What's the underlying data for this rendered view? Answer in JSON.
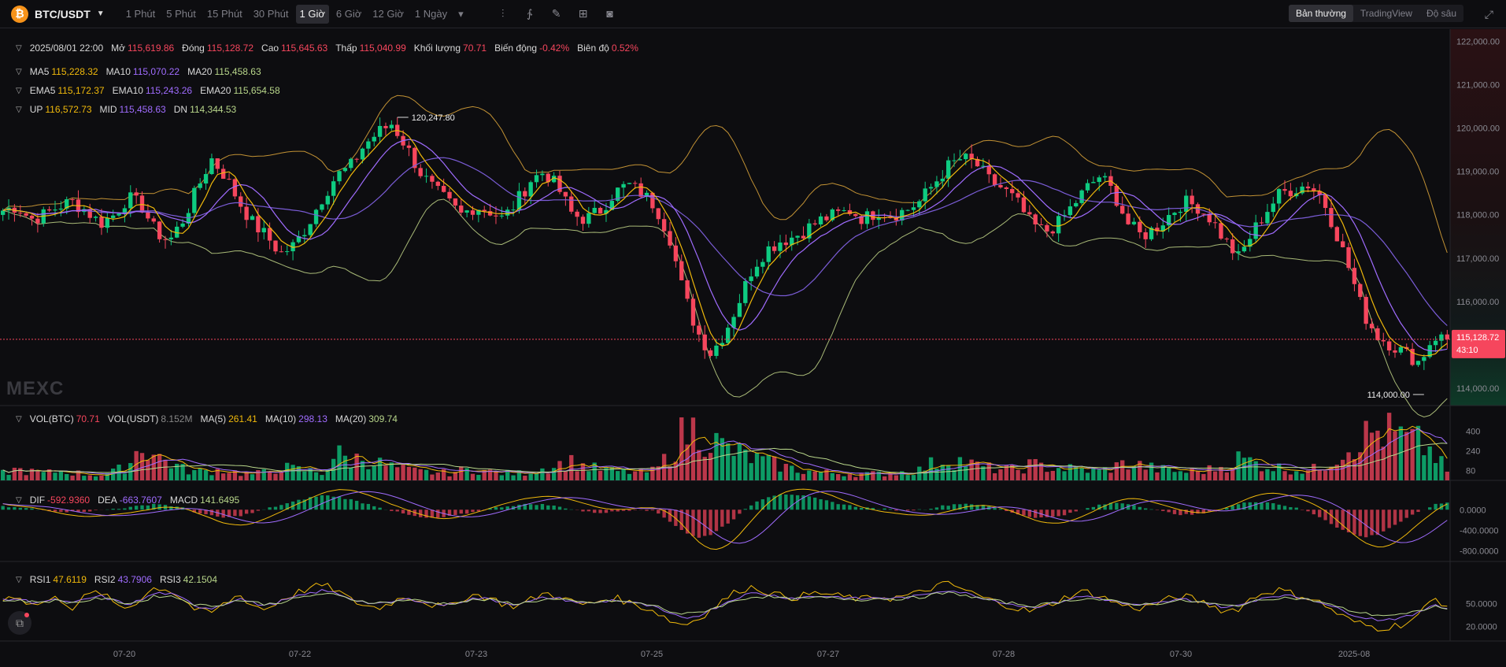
{
  "toolbar": {
    "symbol": "BTC/USDT",
    "logo_glyph": "₿",
    "intervals": [
      "1 Phút",
      "5 Phút",
      "15 Phút",
      "30 Phút",
      "1 Giờ",
      "6 Giờ",
      "12 Giờ",
      "1 Ngày"
    ],
    "active_interval": "1 Giờ",
    "tool_icons": [
      "candle-type-icon",
      "indicator-icon",
      "draw-icon",
      "layout-icon",
      "camera-icon"
    ],
    "views": [
      "Bản thường",
      "TradingView",
      "Độ sâu"
    ],
    "active_view": "Bản thường"
  },
  "ohlc": {
    "date": "2025/08/01 22:00",
    "items": [
      {
        "label": "Mở",
        "value": "115,619.86",
        "color": "red"
      },
      {
        "label": "Đóng",
        "value": "115,128.72",
        "color": "red"
      },
      {
        "label": "Cao",
        "value": "115,645.63",
        "color": "red"
      },
      {
        "label": "Thấp",
        "value": "115,040.99",
        "color": "red"
      },
      {
        "label": "Khối lượng",
        "value": "70.71",
        "color": "red"
      },
      {
        "label": "Biến động",
        "value": "-0.42%",
        "color": "red"
      },
      {
        "label": "Biên độ",
        "value": "0.52%",
        "color": "red"
      }
    ]
  },
  "ma": [
    {
      "label": "MA5",
      "value": "115,228.32",
      "color": "orange"
    },
    {
      "label": "MA10",
      "value": "115,070.22",
      "color": "purple"
    },
    {
      "label": "MA20",
      "value": "115,458.63",
      "color": "green"
    }
  ],
  "ema": [
    {
      "label": "EMA5",
      "value": "115,172.37",
      "color": "orange"
    },
    {
      "label": "EMA10",
      "value": "115,243.26",
      "color": "purple"
    },
    {
      "label": "EMA20",
      "value": "115,654.58",
      "color": "green"
    }
  ],
  "boll": [
    {
      "label": "UP",
      "value": "116,572.73",
      "color": "orange"
    },
    {
      "label": "MID",
      "value": "115,458.63",
      "color": "purple"
    },
    {
      "label": "DN",
      "value": "114,344.53",
      "color": "green"
    }
  ],
  "vol": [
    {
      "label": "VOL(BTC)",
      "value": "70.71",
      "color": "red"
    },
    {
      "label": "VOL(USDT)",
      "value": "8.152M",
      "color": "gray"
    },
    {
      "label": "MA(5)",
      "value": "261.41",
      "color": "orange"
    },
    {
      "label": "MA(10)",
      "value": "298.13",
      "color": "purple"
    },
    {
      "label": "MA(20)",
      "value": "309.74",
      "color": "green"
    }
  ],
  "macd": [
    {
      "label": "DIF",
      "value": "-592.9360",
      "color": "red"
    },
    {
      "label": "DEA",
      "value": "-663.7607",
      "color": "purple"
    },
    {
      "label": "MACD",
      "value": "141.6495",
      "color": "green"
    }
  ],
  "rsi": [
    {
      "label": "RSI1",
      "value": "47.6119",
      "color": "orange"
    },
    {
      "label": "RSI2",
      "value": "43.7906",
      "color": "purple"
    },
    {
      "label": "RSI3",
      "value": "42.1504",
      "color": "green"
    }
  ],
  "watermark": "MEXC",
  "colors": {
    "up": "#0ecb81",
    "down": "#f6465d",
    "orange": "#f0b90b",
    "purple": "#a06cff",
    "green": "#b8d68a",
    "boll_up": "#e2a93b",
    "boll_dn": "#c4d88a",
    "price_line": "#f6465d"
  },
  "chart_data": [
    {
      "type": "candlestick",
      "title": "",
      "x_ticks": [
        "07-20",
        "07-22",
        "07-23",
        "07-25",
        "07-27",
        "07-28",
        "07-30",
        "2025-08"
      ],
      "y_ticks": [
        122000,
        121000,
        120000,
        119000,
        118000,
        117000,
        116000,
        115000,
        114000
      ],
      "y_tick_labels": [
        "122,000.00",
        "121,000.00",
        "120,000.00",
        "119,000.00",
        "118,000.00",
        "117,000.00",
        "116,000.00",
        "115,000.00",
        "114,000.00"
      ],
      "ylim": [
        113600,
        122100
      ],
      "last_price": 115128.72,
      "last_price_label": "115,128.72",
      "countdown": "43:10",
      "high_marker": {
        "value": 120247.8,
        "label": "120,247.80"
      },
      "low_marker": {
        "value": 114000.0,
        "label": "114,000.00"
      },
      "series_close_path": [
        118100,
        118200,
        117900,
        118000,
        118200,
        118300,
        118100,
        117800,
        118000,
        118400,
        118200,
        117600,
        117400,
        117900,
        118600,
        119300,
        118900,
        118300,
        117800,
        117500,
        117100,
        117300,
        117800,
        118400,
        118900,
        119100,
        119600,
        119900,
        120100,
        119600,
        119000,
        118600,
        118300,
        118000,
        118200,
        118100,
        117900,
        118300,
        118800,
        119000,
        118600,
        118000,
        117900,
        118100,
        118500,
        118700,
        118500,
        118200,
        117500,
        116200,
        115300,
        114800,
        115300,
        116000,
        116800,
        117200,
        117400,
        117500,
        117700,
        117900,
        118000,
        118100,
        117900,
        118100,
        118000,
        118100,
        118300,
        118700,
        119100,
        119300,
        119200,
        118800,
        118600,
        118300,
        117800,
        117600,
        117800,
        118200,
        118600,
        118900,
        118500,
        117800,
        117500,
        117700,
        118000,
        118300,
        118200,
        117900,
        117400,
        117000,
        117600,
        118100,
        118500,
        118600,
        118700,
        118400,
        117600,
        116700,
        115700,
        115200,
        115000,
        114800,
        114600,
        115200,
        115129
      ]
    },
    {
      "type": "bar",
      "title": "",
      "y_ticks": [
        400,
        240,
        80
      ],
      "y_tick_labels": [
        "400",
        "240",
        "80"
      ],
      "ylim": [
        0,
        520
      ],
      "values": [
        60,
        90,
        70,
        55,
        80,
        65,
        50,
        45,
        70,
        120,
        300,
        200,
        150,
        90,
        70,
        80,
        90,
        60,
        50,
        70,
        110,
        90,
        80,
        60,
        220,
        160,
        190,
        140,
        110,
        85,
        70,
        65,
        60,
        80,
        95,
        70,
        60,
        55,
        75,
        100,
        130,
        150,
        110,
        90,
        75,
        70,
        65,
        80,
        210,
        380,
        420,
        330,
        260,
        220,
        180,
        150,
        120,
        90,
        75,
        65,
        60,
        55,
        50,
        55,
        60,
        70,
        85,
        140,
        170,
        160,
        120,
        100,
        90,
        85,
        130,
        110,
        100,
        95,
        85,
        75,
        110,
        140,
        120,
        95,
        80,
        70,
        75,
        90,
        120,
        180,
        150,
        120,
        100,
        90,
        80,
        110,
        200,
        290,
        350,
        400,
        380,
        330,
        300,
        220,
        71
      ]
    },
    {
      "type": "bar",
      "title": "",
      "y_ticks": [
        0,
        -400,
        -800
      ],
      "y_tick_labels": [
        "0.0000",
        "-400.0000",
        "-800.0000"
      ],
      "ylim": [
        -950,
        450
      ],
      "values": [
        60,
        40,
        20,
        -10,
        -30,
        -40,
        -30,
        -10,
        20,
        40,
        80,
        120,
        80,
        30,
        -60,
        -120,
        -160,
        -120,
        -60,
        20,
        90,
        160,
        230,
        280,
        260,
        200,
        130,
        60,
        -20,
        -90,
        -150,
        -170,
        -140,
        -90,
        -40,
        20,
        60,
        90,
        110,
        100,
        60,
        10,
        -40,
        -60,
        -40,
        -10,
        10,
        -40,
        -220,
        -420,
        -560,
        -480,
        -300,
        -100,
        120,
        250,
        310,
        300,
        250,
        190,
        130,
        80,
        40,
        20,
        0,
        -10,
        0,
        40,
        90,
        120,
        110,
        60,
        0,
        -80,
        -140,
        -160,
        -120,
        -60,
        20,
        90,
        140,
        120,
        60,
        -10,
        -60,
        -100,
        -90,
        -40,
        30,
        110,
        160,
        150,
        100,
        40,
        -40,
        -160,
        -330,
        -460,
        -540,
        -480,
        -330,
        -180,
        -40,
        90,
        142
      ]
    },
    {
      "type": "line",
      "title": "",
      "y_ticks": [
        50,
        20
      ],
      "y_tick_labels": [
        "50.0000",
        "20.0000"
      ],
      "ylim": [
        5,
        95
      ],
      "series": [
        {
          "name": "RSI1",
          "values": [
            55,
            62,
            48,
            52,
            58,
            45,
            60,
            66,
            50,
            44,
            58,
            72,
            68,
            55,
            40,
            38,
            50,
            62,
            48,
            42,
            55,
            63,
            70,
            74,
            68,
            55,
            48,
            44,
            52,
            60,
            55,
            48,
            44,
            56,
            62,
            58,
            50,
            46,
            55,
            64,
            60,
            52,
            48,
            54,
            58,
            52,
            46,
            40,
            28,
            22,
            30,
            42,
            56,
            68,
            72,
            66,
            60,
            58,
            62,
            64,
            60,
            58,
            55,
            60,
            57,
            60,
            64,
            72,
            76,
            70,
            62,
            55,
            50,
            44,
            40,
            46,
            54,
            62,
            66,
            60,
            52,
            46,
            44,
            50,
            56,
            60,
            54,
            48,
            40,
            44,
            58,
            66,
            68,
            62,
            58,
            50,
            38,
            28,
            22,
            18,
            20,
            24,
            35,
            58,
            47.6
          ]
        },
        {
          "name": "RSI2",
          "values": [
            54,
            57,
            52,
            53,
            55,
            50,
            56,
            60,
            54,
            49,
            55,
            64,
            63,
            56,
            46,
            44,
            50,
            57,
            51,
            47,
            53,
            58,
            63,
            67,
            64,
            57,
            52,
            49,
            52,
            56,
            54,
            50,
            48,
            53,
            57,
            56,
            52,
            49,
            53,
            58,
            57,
            53,
            50,
            52,
            55,
            52,
            49,
            45,
            36,
            31,
            34,
            42,
            51,
            59,
            64,
            62,
            59,
            57,
            59,
            60,
            59,
            57,
            56,
            58,
            57,
            58,
            60,
            65,
            68,
            65,
            60,
            56,
            52,
            48,
            45,
            48,
            52,
            57,
            60,
            57,
            53,
            49,
            47,
            50,
            53,
            56,
            53,
            50,
            45,
            47,
            54,
            59,
            61,
            59,
            56,
            52,
            44,
            37,
            32,
            29,
            30,
            32,
            38,
            50,
            43.8
          ]
        },
        {
          "name": "RSI3",
          "values": [
            53,
            55,
            52,
            53,
            54,
            51,
            54,
            57,
            54,
            50,
            53,
            60,
            60,
            55,
            48,
            47,
            50,
            55,
            52,
            49,
            52,
            56,
            60,
            63,
            61,
            56,
            53,
            51,
            52,
            55,
            54,
            51,
            50,
            52,
            55,
            55,
            52,
            50,
            52,
            56,
            55,
            53,
            51,
            52,
            54,
            52,
            50,
            47,
            40,
            36,
            38,
            43,
            49,
            55,
            59,
            59,
            57,
            56,
            57,
            58,
            57,
            56,
            55,
            57,
            56,
            57,
            58,
            62,
            64,
            62,
            58,
            55,
            52,
            50,
            47,
            49,
            52,
            55,
            57,
            55,
            53,
            50,
            49,
            50,
            52,
            54,
            52,
            50,
            47,
            48,
            52,
            56,
            58,
            57,
            55,
            52,
            46,
            41,
            37,
            35,
            35,
            36,
            40,
            47,
            42.2
          ]
        }
      ]
    }
  ]
}
